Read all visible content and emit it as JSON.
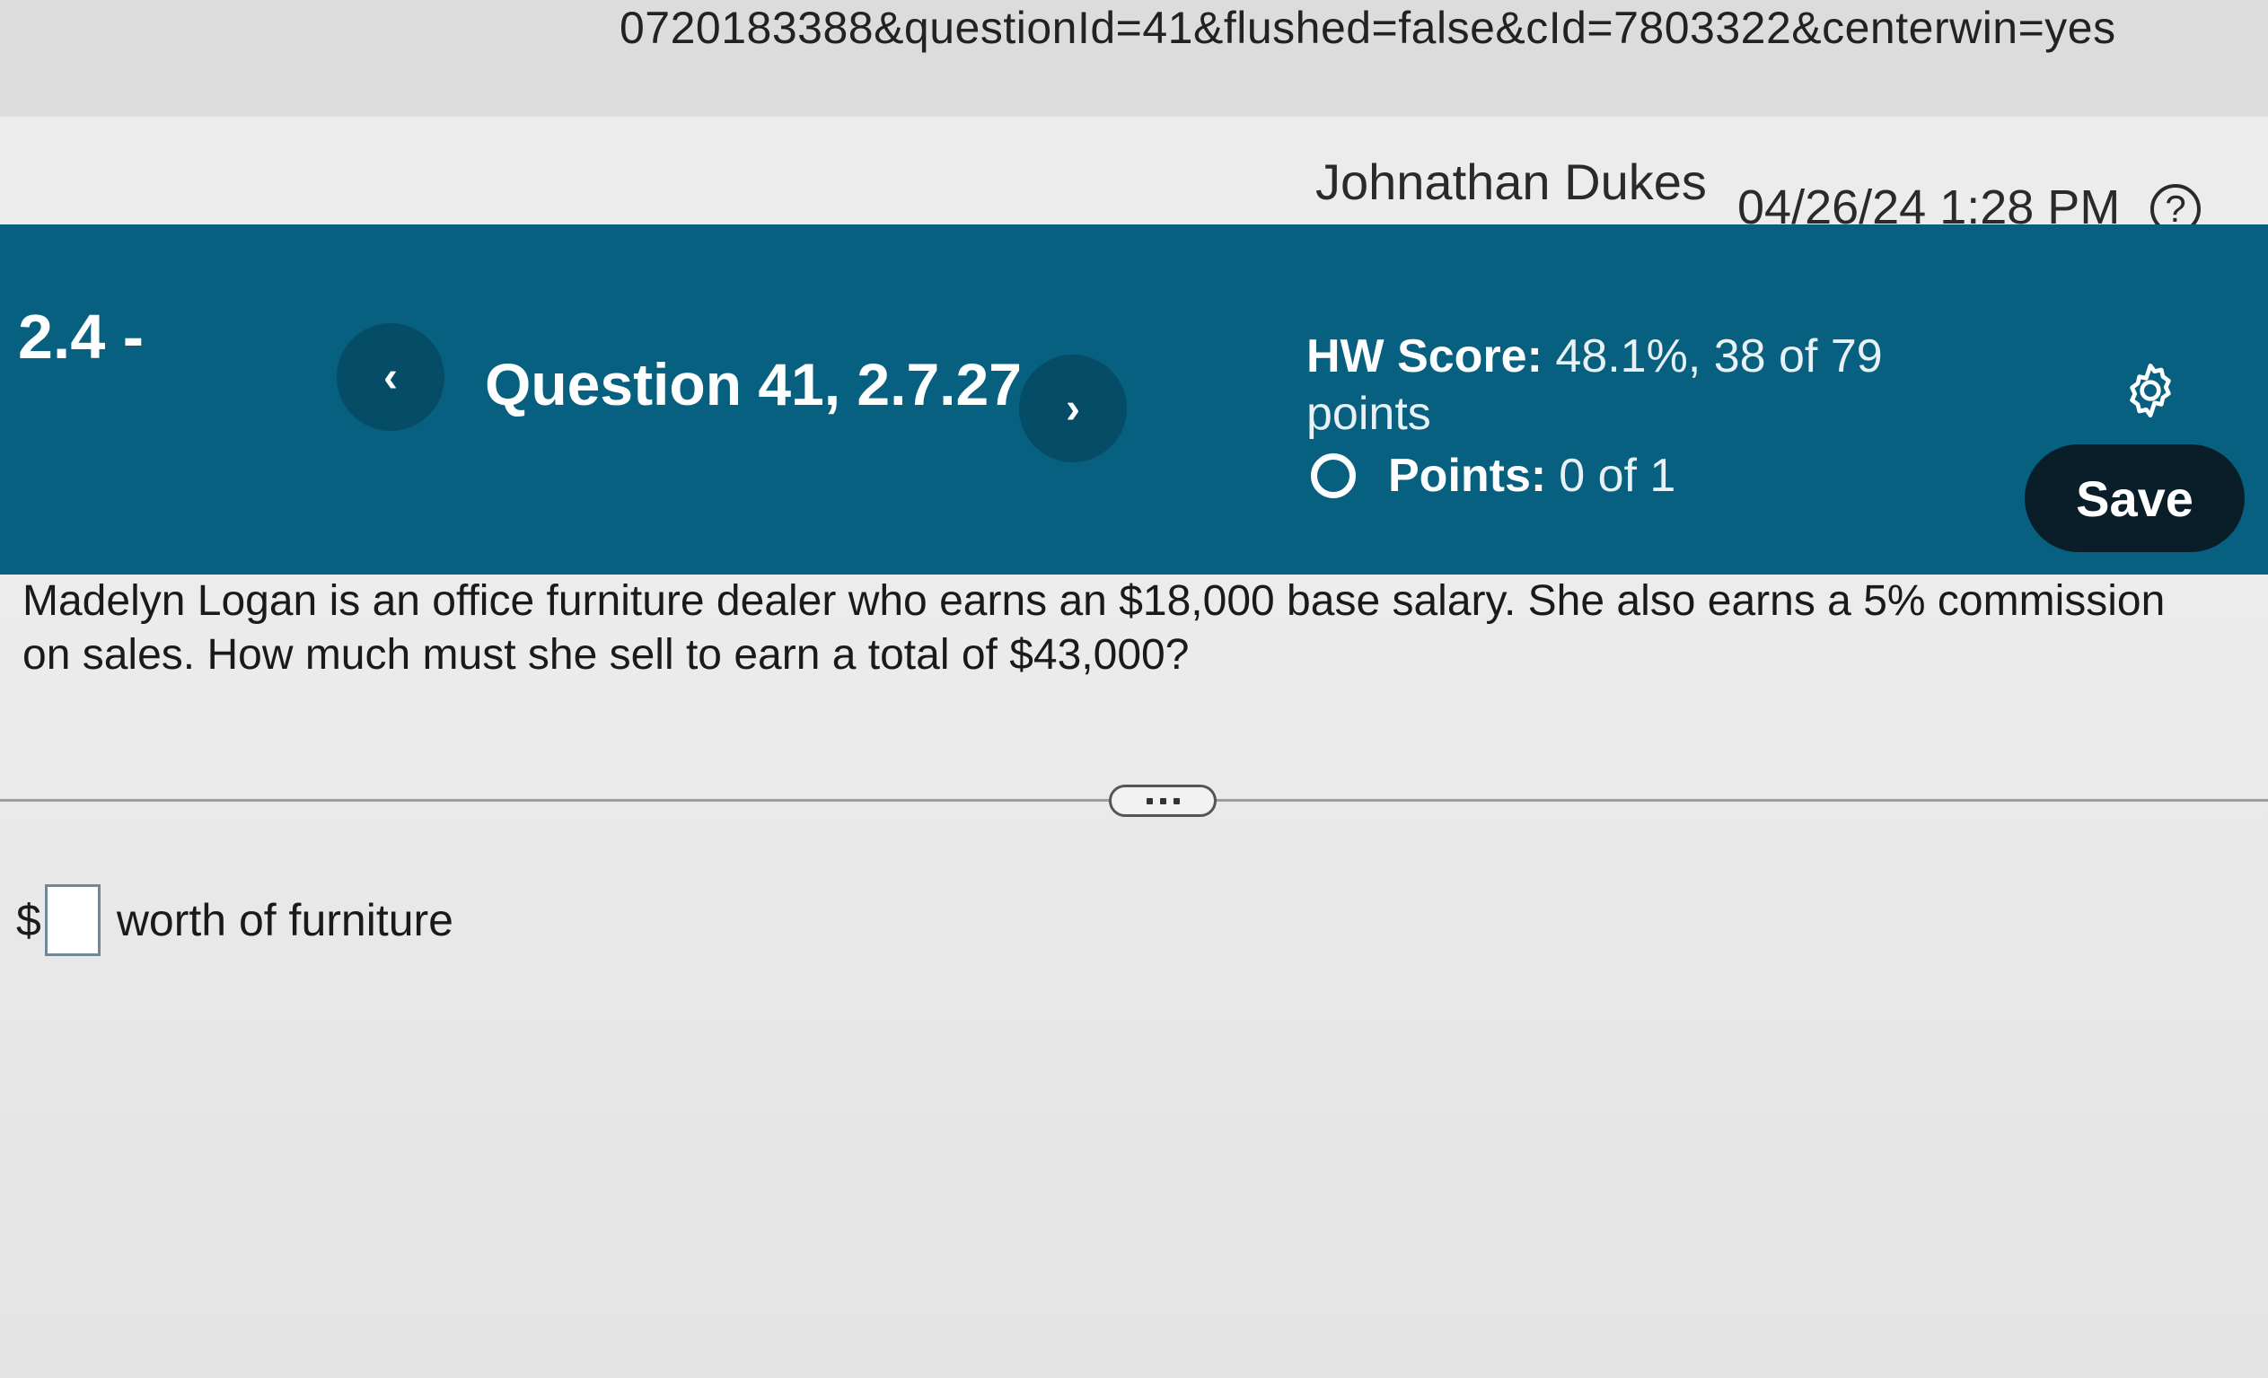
{
  "browser": {
    "url_fragment": "0720183388&questionId=41&flushed=false&cId=7803322&centerwin=yes"
  },
  "user": {
    "name": "Johnathan Dukes",
    "datetime": "04/26/24 1:28 PM",
    "help_label": "?"
  },
  "header": {
    "section": "2.4 -",
    "prev_label": "‹",
    "next_label": "›",
    "question_title": "Question 41, 2.7.27",
    "hw_score_label": "HW Score:",
    "hw_score_value": "48.1%, 38 of 79 points",
    "points_label": "Points:",
    "points_value": "0 of 1",
    "save_label": "Save"
  },
  "question": {
    "text": "Madelyn Logan is an office furniture dealer who earns an $18,000 base salary. She also earns a 5% commission on sales. How much must she sell to earn a total of $43,000?"
  },
  "answer": {
    "prefix": "$",
    "value": "",
    "suffix": "worth of furniture"
  },
  "colors": {
    "header_bg": "#07607f",
    "nav_btn_bg": "#054c66",
    "save_bg": "#0a1e2a"
  },
  "icons": {
    "help": "question-circle-icon",
    "settings": "gear-icon",
    "points_status": "circle-outline-icon"
  }
}
